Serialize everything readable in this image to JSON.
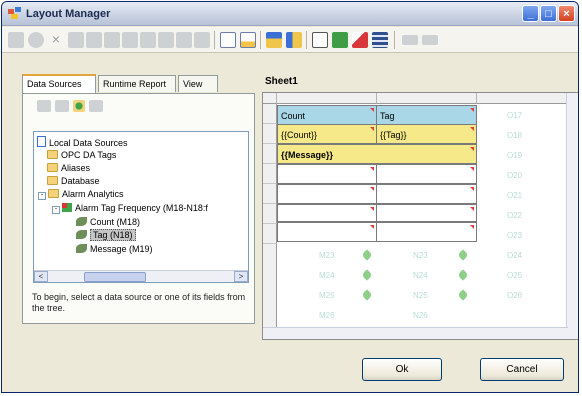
{
  "window": {
    "title": "Layout Manager"
  },
  "tabs": [
    "Data Sources",
    "Runtime Report",
    "View"
  ],
  "tree": {
    "root": "Local Data Sources",
    "items": [
      {
        "label": "OPC DA Tags",
        "kind": "folder"
      },
      {
        "label": "Aliases",
        "kind": "folder"
      },
      {
        "label": "Database",
        "kind": "folder"
      },
      {
        "label": "Alarm Analytics",
        "kind": "folder"
      },
      {
        "label": "Alarm Tag Frequency (M18-N18:f",
        "kind": "source"
      },
      {
        "label": "Count (M18)",
        "kind": "field"
      },
      {
        "label": "Tag (N18)",
        "kind": "field",
        "selected": true
      },
      {
        "label": "Message (M19)",
        "kind": "field"
      }
    ]
  },
  "hint_text": "To begin, select a data source or one of its fields from the tree.",
  "sheet": {
    "title": "Sheet1",
    "header_row": [
      "Count",
      "Tag"
    ],
    "data_row": [
      "{{Count}}",
      "{{Tag}}"
    ],
    "message_row": "{{Message}}",
    "ghost_refs": [
      "O17",
      "O18",
      "O19",
      "O20",
      "O21",
      "O22",
      "O23",
      "O24",
      "O25",
      "O26"
    ],
    "ghost_left": [
      "M23",
      "M24",
      "M25",
      "M26"
    ],
    "ghost_mid": [
      "N23",
      "N24",
      "N25",
      "N26"
    ]
  },
  "buttons": {
    "ok": "Ok",
    "cancel": "Cancel"
  },
  "colors": {
    "accent": "#3c6fd6",
    "header_cell": "#a9d7e8",
    "data_cell": "#f6e98a"
  }
}
